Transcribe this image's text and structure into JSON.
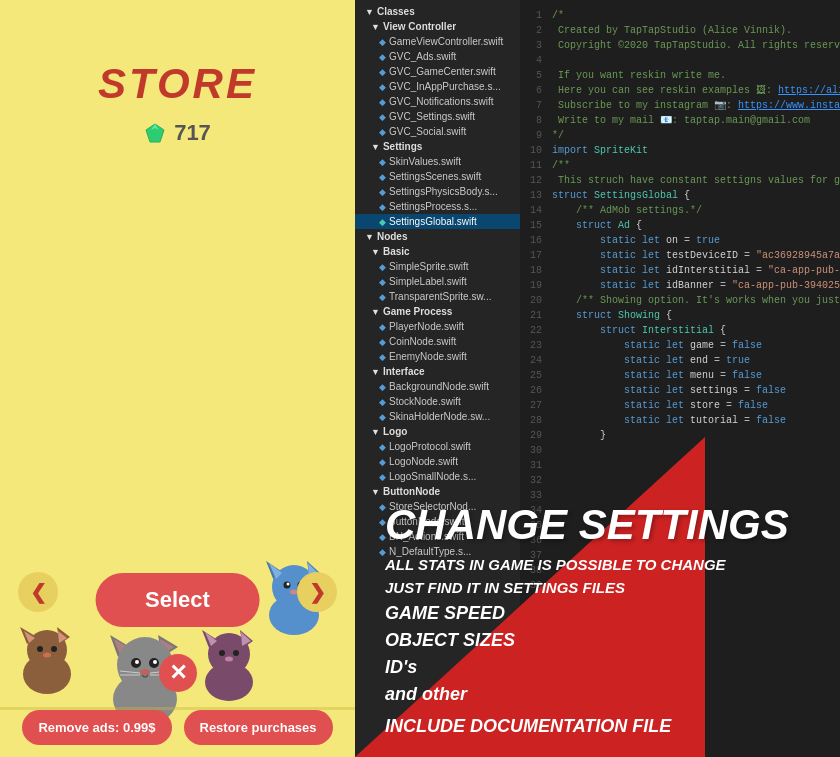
{
  "left": {
    "title": "STORE",
    "gem_count": "717",
    "select_label": "Select",
    "close_symbol": "✕",
    "left_arrow": "❮",
    "right_arrow": "❯",
    "remove_ads_label": "Remove ads: 0.99$",
    "restore_label": "Restore purchases"
  },
  "right": {
    "overlay_title": "CHANGE SETTINGS",
    "overlay_subtitle": "ALL STATS IN GAME IS POSSIBLE TO CHANGE",
    "overlay_subtitle2": "JUST FIND IT IN SETTINGS FILES",
    "overlay_list": [
      "GAME SPEED",
      "OBJECT SIZES",
      "ID's",
      "and other"
    ],
    "overlay_footer": "INCLUDE DOCUMENTATION FILE",
    "file_tree": [
      {
        "label": "Classes",
        "indent": 0,
        "type": "folder"
      },
      {
        "label": "View Controller",
        "indent": 1,
        "type": "folder"
      },
      {
        "label": "GameViewController.swift",
        "indent": 2,
        "type": "file"
      },
      {
        "label": "GVC_Ads.swift",
        "indent": 2,
        "type": "file"
      },
      {
        "label": "GVC_GameCenter.swift",
        "indent": 2,
        "type": "file"
      },
      {
        "label": "GVC_InAppPurchase.s...",
        "indent": 2,
        "type": "file"
      },
      {
        "label": "GVC_Notifications.swift",
        "indent": 2,
        "type": "file"
      },
      {
        "label": "GVC_Settings.swift",
        "indent": 2,
        "type": "file"
      },
      {
        "label": "GVC_Social.swift",
        "indent": 2,
        "type": "file"
      },
      {
        "label": "Settings",
        "indent": 1,
        "type": "folder"
      },
      {
        "label": "SkinValues.swift",
        "indent": 2,
        "type": "file"
      },
      {
        "label": "SettingsScenes.swift",
        "indent": 2,
        "type": "file"
      },
      {
        "label": "SettingsPhysicsBody.s...",
        "indent": 2,
        "type": "file"
      },
      {
        "label": "SettingsProcess.s...",
        "indent": 2,
        "type": "file"
      },
      {
        "label": "SettingsGlobal.swift",
        "indent": 2,
        "type": "file",
        "selected": true
      },
      {
        "label": "Nodes",
        "indent": 0,
        "type": "folder"
      },
      {
        "label": "Basic",
        "indent": 1,
        "type": "folder"
      },
      {
        "label": "SimpleSprite.swift",
        "indent": 2,
        "type": "file"
      },
      {
        "label": "SimpleLabel.swift",
        "indent": 2,
        "type": "file"
      },
      {
        "label": "TransparentSprite.sw...",
        "indent": 2,
        "type": "file"
      },
      {
        "label": "Game Process",
        "indent": 1,
        "type": "folder"
      },
      {
        "label": "PlayerNode.swift",
        "indent": 2,
        "type": "file"
      },
      {
        "label": "CoinNode.swift",
        "indent": 2,
        "type": "file"
      },
      {
        "label": "EnemyNode.swift",
        "indent": 2,
        "type": "file"
      },
      {
        "label": "Interface",
        "indent": 1,
        "type": "folder"
      },
      {
        "label": "BackgroundNode.swift",
        "indent": 2,
        "type": "file"
      },
      {
        "label": "StockNode.swift",
        "indent": 2,
        "type": "file"
      },
      {
        "label": "SkinaHolderNode.sw...",
        "indent": 2,
        "type": "file"
      },
      {
        "label": "Logo",
        "indent": 1,
        "type": "folder"
      },
      {
        "label": "LogoProtocol.swift",
        "indent": 2,
        "type": "file"
      },
      {
        "label": "LogoNode.swift",
        "indent": 2,
        "type": "file"
      },
      {
        "label": "LogoSmallNode.s...",
        "indent": 2,
        "type": "file"
      },
      {
        "label": "ButtonNode",
        "indent": 1,
        "type": "folder"
      },
      {
        "label": "StoreSelectorNod...",
        "indent": 2,
        "type": "file"
      },
      {
        "label": "ButtonNode.swift",
        "indent": 2,
        "type": "file"
      },
      {
        "label": "BN_Actions.swift",
        "indent": 2,
        "type": "file"
      },
      {
        "label": "N_DefaultType.s...",
        "indent": 2,
        "type": "file"
      }
    ]
  }
}
